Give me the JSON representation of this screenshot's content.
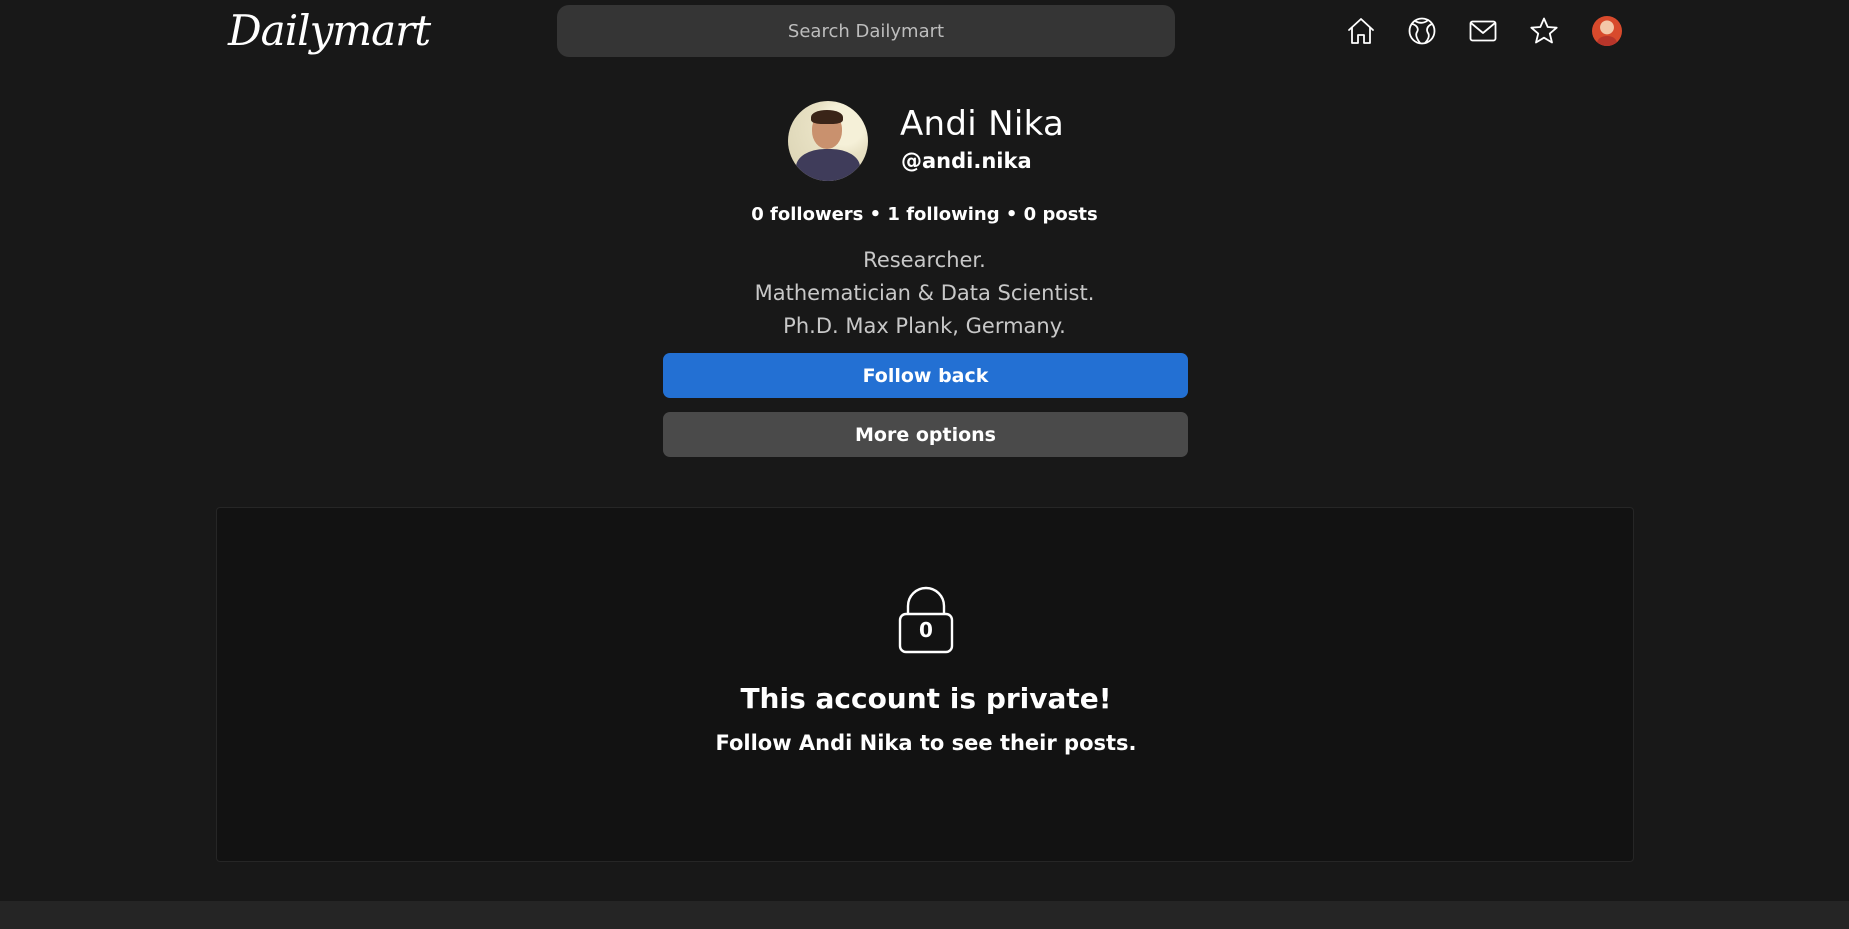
{
  "header": {
    "logo": "Dailymart",
    "search_placeholder": "Search Dailymart",
    "nav_icons": [
      "home-icon",
      "explore-icon",
      "mail-icon",
      "star-icon",
      "profile-avatar"
    ]
  },
  "profile": {
    "name": "Andi Nika",
    "handle": "@andi.nika",
    "stats": "0 followers • 1 following • 0 posts",
    "bio": [
      "Researcher.",
      "Mathematician & Data Scientist.",
      "Ph.D. Max Plank, Germany."
    ],
    "follow_button": "Follow back",
    "more_button": "More options"
  },
  "private": {
    "lock_count": "0",
    "title": "This account is private!",
    "subtitle": "Follow Andi Nika to see their posts."
  },
  "colors": {
    "background": "#181818",
    "accent": "#2370d3",
    "secondary_button": "#4a4a4a",
    "search_bg": "#353535"
  }
}
